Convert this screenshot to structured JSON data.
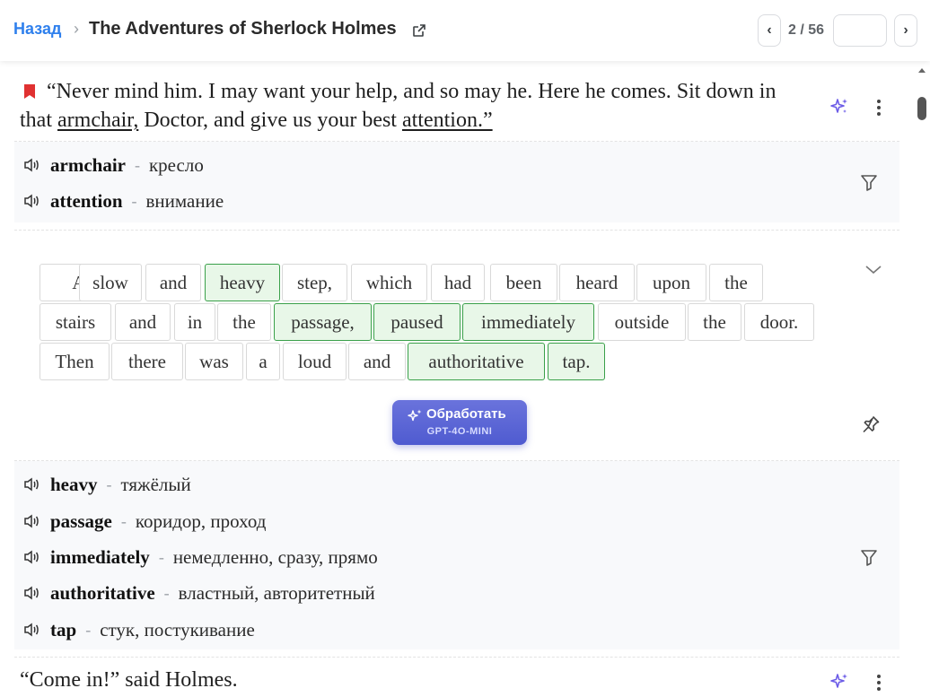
{
  "header": {
    "back_label": "Назад",
    "separator": "›",
    "book_title": "The Adventures of Sherlock Holmes",
    "prev_label": "‹",
    "next_label": "›",
    "page_indicator": "2 / 56",
    "page_input_value": ""
  },
  "sentence1": {
    "part1": "“Never mind him. I may want your help, and so may he. Here he comes. Sit down in that ",
    "highlight1": "armchair,",
    "part2": " Doctor, and give us your best ",
    "highlight2": "attention.”"
  },
  "vocab1": [
    {
      "word": "armchair",
      "translation": "кресло"
    },
    {
      "word": "attention",
      "translation": "внимание"
    }
  ],
  "sentence2_words": [
    "A",
    "slow",
    "and",
    "heavy",
    "step,",
    "which",
    "had",
    "been",
    "heard",
    "upon",
    "the",
    "stairs",
    "and",
    "in",
    "the",
    "passage,",
    "paused",
    "immediately",
    "outside",
    "the",
    "door.",
    "Then",
    "there",
    "was",
    "a",
    "loud",
    "and",
    "authoritative",
    "tap."
  ],
  "selected_words": [
    "heavy",
    "passage,",
    "paused",
    "immediately",
    "authoritative",
    "tap."
  ],
  "process_button": {
    "label": "Обработать",
    "model": "GPT-4O-MINI"
  },
  "vocab2": [
    {
      "word": "heavy",
      "translation": "тяжёлый"
    },
    {
      "word": "passage",
      "translation": "коридор, проход"
    },
    {
      "word": "immediately",
      "translation": "немедленно, сразу, прямо"
    },
    {
      "word": "authoritative",
      "translation": "властный, авторитетный"
    },
    {
      "word": "tap",
      "translation": "стук, постукивание"
    }
  ],
  "vocab_dash": "-",
  "sentence3": "“Come in!” said Holmes.",
  "colors": {
    "accent": "#2f80ed",
    "selected_bg": "#e8f7e8",
    "selected_border": "#3aa04a",
    "bookmark": "#e03131",
    "sparkle": "#6c5ce7"
  }
}
